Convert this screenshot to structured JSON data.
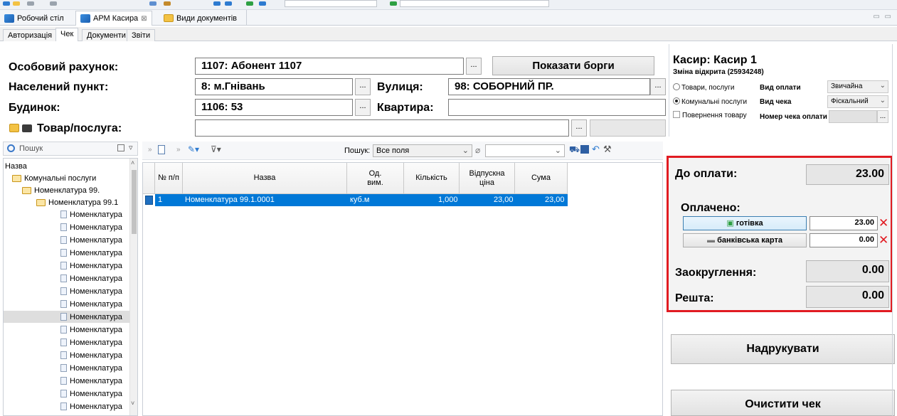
{
  "tabs": {
    "desktop": "Робочий стіл",
    "cashier": "АРМ Касира",
    "cashier_close": "⊠",
    "doc_types": "Види документів"
  },
  "subtabs": [
    "Авторизація",
    "Чек",
    "Документи",
    "Звіти"
  ],
  "header": {
    "account_label": "Особовий рахунок:",
    "account_value": "1107: Абонент 1107",
    "show_debts": "Показати борги",
    "city_label": "Населений пункт:",
    "city_value": "8: м.Гнівань",
    "street_label": "Вулиця:",
    "street_value": "98: СОБОРНИЙ ПР.",
    "building_label": "Будинок:",
    "building_value": "1106: 53",
    "apartment_label": "Квартира:",
    "apartment_value": "",
    "product_label": "Товар/послуга:",
    "product_value": "",
    "ellipsis": "..."
  },
  "cashier": {
    "title": "Касир: Касир 1",
    "shift": "Зміна відкрита (25934248)",
    "radio_goods": "Товари, послуги",
    "radio_utility": "Комунальні послуги",
    "payment_type_label": "Вид оплати",
    "payment_type_value": "Звичайна",
    "check_type_label": "Вид чека",
    "check_type_value": "Фіскальний",
    "return_label": "Повернення товару",
    "check_number_label": "Номер чека оплати"
  },
  "tree": {
    "search_label": "Пошук",
    "column_header": "Назва",
    "items": [
      "Комунальні послуги",
      "Номенклатура 99.",
      "Номенклатура 99.1",
      "Номенклатура",
      "Номенклатура",
      "Номенклатура",
      "Номенклатура",
      "Номенклатура",
      "Номенклатура",
      "Номенклатура",
      "Номенклатура",
      "Номенклатура",
      "Номенклатура",
      "Номенклатура",
      "Номенклатура",
      "Номенклатура",
      "Номенклатура",
      "Номенклатура",
      "Номенклатура"
    ]
  },
  "grid": {
    "search_label": "Пошук:",
    "search_scope": "Все поля",
    "columns": [
      "№ п/п",
      "Назва",
      "Од. вим.",
      "Кількість",
      "Відпускна ціна",
      "Сума"
    ],
    "rows": [
      {
        "num": "1",
        "name": "Номенклатура 99.1.0001",
        "unit": "куб.м",
        "qty": "1,000",
        "price": "23,00",
        "sum": "23,00"
      }
    ]
  },
  "payment": {
    "due_label": "До оплати:",
    "due_value": "23.00",
    "paid_label": "Оплачено:",
    "cash_label": "готівка",
    "cash_value": "23.00",
    "card_label": "банківська карта",
    "card_value": "0.00",
    "rounding_label": "Заокруглення:",
    "rounding_value": "0.00",
    "change_label": "Решта:",
    "change_value": "0.00"
  },
  "actions": {
    "print": "Надрукувати",
    "clear": "Очистити чек"
  },
  "colors": {
    "selection": "#0078d7",
    "highlight_border": "#e11b22"
  }
}
